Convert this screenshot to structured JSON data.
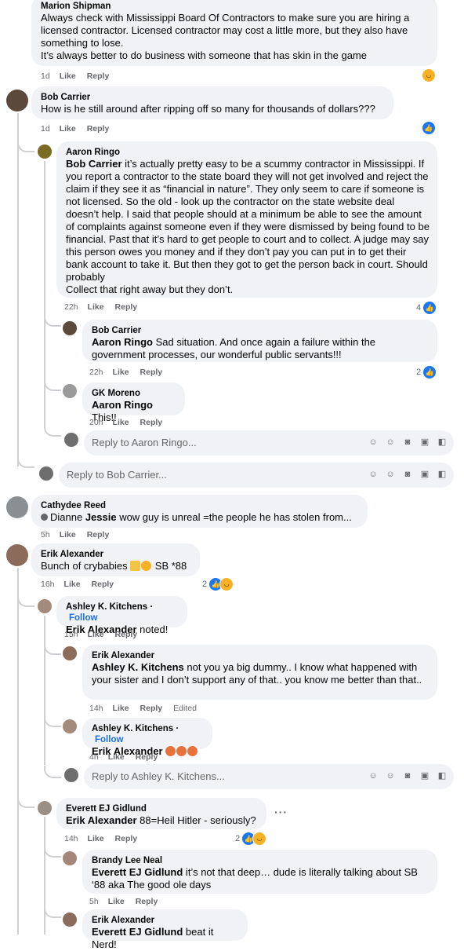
{
  "comments": {
    "marion": {
      "author": "Marion Shipman",
      "text": "Always check with Mississippi Board Of Contractors to make sure you are hiring a licensed contractor. Licensed contractor may cost a little more, but they also have something to lose.\nIt’s always better to do business with someone that has skin in the game",
      "time": "1d",
      "like": "Like",
      "reply": "Reply"
    },
    "bob": {
      "author": "Bob Carrier",
      "text": "How is he still around after ripping off so many for thousands of dollars???",
      "time": "1d",
      "like": "Like",
      "reply": "Reply"
    },
    "aaron": {
      "author": "Aaron Ringo",
      "mention": "Bob Carrier",
      "text": " it’s actually pretty easy to be a scummy contractor in Mississippi. If you report a contractor to the state board they will not get involved and reject the claim if they see it as “financial in nature”. They only seem to care if someone is not licensed. So the old - look up the contractor on the state website deal doesn’t help. I said that people should at a minimum be able to see the amount of complaints against someone even if they were dismissed by being found to be financial. Past that it’s hard to get people to court and to collect. A judge may say this person owes you money and if they don’t pay you can put in to get their bank account to take it. But then they got to get the person back in court. Should probably\nCollect that right away but they don’t.",
      "time": "22h",
      "like": "Like",
      "reply": "Reply",
      "reaction_count": "4"
    },
    "bob_reply": {
      "author": "Bob Carrier",
      "mention": "Aaron Ringo",
      "text": " Sad situation. And once again a failure within the government processes, our wonderful public servants!!!",
      "time": "22h",
      "like": "Like",
      "reply": "Reply",
      "reaction_count": "2"
    },
    "gk": {
      "author": "GK Moreno",
      "mention": "Aaron Ringo",
      "text": " This!!",
      "time": "20h",
      "like": "Like",
      "reply": "Reply"
    },
    "cathydee": {
      "author": "Cathydee Reed",
      "prefix": "Dianne ",
      "mention": "Jessie",
      "text": " wow guy is unreal =the people he has stolen from...",
      "time": "5h",
      "like": "Like",
      "reply": "Reply"
    },
    "erik": {
      "author": "Erik Alexander",
      "text": "Bunch of crybabies ",
      "suffix": " SB *88",
      "time": "16h",
      "like": "Like",
      "reply": "Reply",
      "reaction_count": "2"
    },
    "ashley1": {
      "author": "Ashley K. Kitchens",
      "follow": "Follow",
      "mention": "Erik Alexander",
      "text": " noted!",
      "time": "15h",
      "like": "Like",
      "reply": "Reply"
    },
    "erik2": {
      "author": "Erik Alexander",
      "mention": "Ashley K. Kitchens",
      "text": " not you ya big dummy.. I know what happened with your sister and I don’t support any of that.. you know me better than that..",
      "time": "14h",
      "like": "Like",
      "reply": "Reply",
      "edited": "Edited"
    },
    "ashley2": {
      "author": "Ashley K. Kitchens",
      "follow": "Follow",
      "mention": "Erik Alexander",
      "text": " ",
      "time": "4h",
      "like": "Like",
      "reply": "Reply"
    },
    "everett": {
      "author": "Everett EJ Gidlund",
      "mention": "Erik Alexander",
      "text": " 88=Heil Hitler - seriously?",
      "time": "14h",
      "like": "Like",
      "reply": "Reply",
      "reaction_count": "2",
      "more": "···"
    },
    "brandy": {
      "author": "Brandy Lee Neal",
      "mention": "Everett EJ Gidlund",
      "text": " it’s not that deep… dude is literally talking about SB ‘88 aka The good ole days",
      "time": "5h",
      "like": "Like",
      "reply": "Reply"
    },
    "erik3": {
      "author": "Erik Alexander",
      "mention": "Everett EJ Gidlund",
      "text": " beat it Nerd!"
    }
  },
  "reply_boxes": {
    "aaron": "Reply to Aaron Ringo...",
    "bob": "Reply to Bob Carrier...",
    "ashley": "Reply to Ashley K. Kitchens..."
  },
  "icons": {
    "like_reaction": "like-icon",
    "haha_reaction": "haha-icon",
    "heart_emoji": "orange-heart-icon",
    "reply_tools": [
      "avatar-sticker-icon",
      "emoji-icon",
      "camera-icon",
      "gif-icon",
      "sticker-icon"
    ]
  },
  "colors": {
    "bubble": "#f0f2f5",
    "meta_text": "#65676b",
    "like_blue": "#1877f2",
    "follow_blue": "#216fdb",
    "haha_yellow": "#f7b125",
    "heart_orange": "#e8713c"
  }
}
